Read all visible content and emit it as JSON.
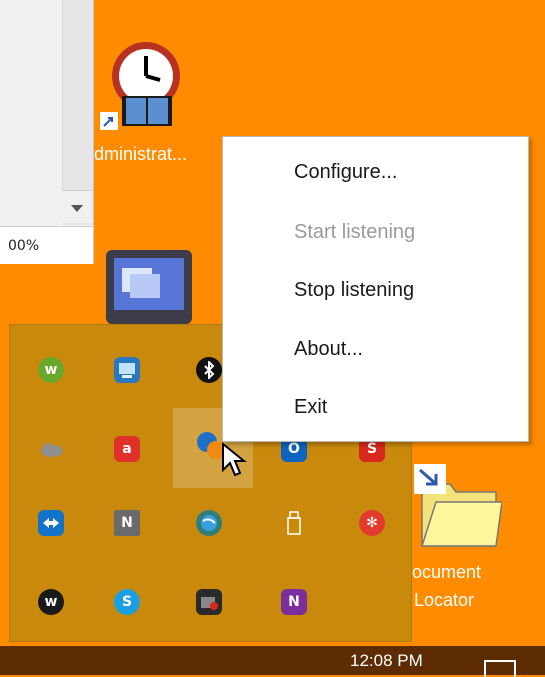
{
  "window": {
    "zoom_text": "00%"
  },
  "desktop": {
    "icons": [
      {
        "label": "dministrat...",
        "icon": "clock-book-icon"
      },
      {
        "label": "",
        "icon": "computer-icon"
      },
      {
        "label_line1": "ocument",
        "label_line2": "Locator",
        "icon": "folder-icon"
      }
    ]
  },
  "tray": {
    "icons": [
      "w-icon",
      "network-icon",
      "bluetooth-icon",
      "",
      "onedrive-icon",
      "a-icon",
      "blue-orange-icon",
      "outlook-icon",
      "s-icon",
      "teamviewer-icon",
      "n-icon",
      "globe-icon",
      "usb-icon",
      "red-gear-icon",
      "w-record-icon",
      "skype-icon",
      "camera-icon",
      "onenote-clip-icon"
    ]
  },
  "context_menu": {
    "items": [
      {
        "label": "Configure...",
        "enabled": true
      },
      {
        "label": "Start listening",
        "enabled": false
      },
      {
        "label": "Stop listening",
        "enabled": true
      },
      {
        "label": "About...",
        "enabled": true
      },
      {
        "label": "Exit",
        "enabled": true
      }
    ]
  },
  "taskbar": {
    "clock": "12:08 PM"
  },
  "colors": {
    "desktop": "#ff8c00",
    "tray": "#c8890c",
    "taskbar": "#5e2c02"
  }
}
